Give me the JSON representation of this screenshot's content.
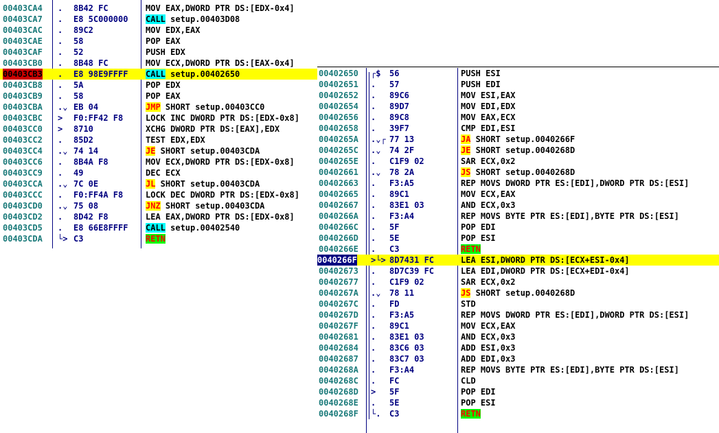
{
  "left_pane": {
    "rows": [
      {
        "addr": "00403CA4",
        "mark": ".",
        "hex": "8B42 FC",
        "kw": "",
        "kwt": "plain",
        "rest": "MOV EAX,DWORD PTR DS:[EDX-0x4]"
      },
      {
        "addr": "00403CA7",
        "mark": ".",
        "hex": "E8 5C000000",
        "kw": "CALL",
        "kwt": "call",
        "rest": " setup.00403D08"
      },
      {
        "addr": "00403CAC",
        "mark": ".",
        "hex": "89C2",
        "kw": "",
        "kwt": "plain",
        "rest": "MOV EDX,EAX"
      },
      {
        "addr": "00403CAE",
        "mark": ".",
        "hex": "58",
        "kw": "",
        "kwt": "plain",
        "rest": "POP EAX"
      },
      {
        "addr": "00403CAF",
        "mark": ".",
        "hex": "52",
        "kw": "",
        "kwt": "plain",
        "rest": "PUSH EDX"
      },
      {
        "addr": "00403CB0",
        "mark": ".",
        "hex": "8B48 FC",
        "kw": "",
        "kwt": "plain",
        "rest": "MOV ECX,DWORD PTR DS:[EAX-0x4]"
      },
      {
        "addr": "00403CB3",
        "mark": ".",
        "hex": "E8 98E9FFFF",
        "kw": "CALL",
        "kwt": "call",
        "rest": " setup.00402650",
        "current": true
      },
      {
        "addr": "00403CB8",
        "mark": ".",
        "hex": "5A",
        "kw": "",
        "kwt": "plain",
        "rest": "POP EDX"
      },
      {
        "addr": "00403CB9",
        "mark": ".",
        "hex": "58",
        "kw": "",
        "kwt": "plain",
        "rest": "POP EAX"
      },
      {
        "addr": "00403CBA",
        "mark": ".⌄",
        "hex": "EB 04",
        "kw": "JMP",
        "kwt": "jmp",
        "rest": " SHORT setup.00403CC0"
      },
      {
        "addr": "00403CBC",
        "mark": ">",
        "hex": "F0:FF42 F8",
        "kw": "",
        "kwt": "plain",
        "rest": "LOCK INC DWORD PTR DS:[EDX-0x8]"
      },
      {
        "addr": "00403CC0",
        "mark": ">",
        "hex": "8710",
        "kw": "",
        "kwt": "plain",
        "rest": "XCHG DWORD PTR DS:[EAX],EDX"
      },
      {
        "addr": "00403CC2",
        "mark": ".",
        "hex": "85D2",
        "kw": "",
        "kwt": "plain",
        "rest": "TEST EDX,EDX"
      },
      {
        "addr": "00403CC4",
        "mark": ".⌄",
        "hex": "74 14",
        "kw": "JE",
        "kwt": "jcc",
        "rest": " SHORT setup.00403CDA"
      },
      {
        "addr": "00403CC6",
        "mark": ".",
        "hex": "8B4A F8",
        "kw": "",
        "kwt": "plain",
        "rest": "MOV ECX,DWORD PTR DS:[EDX-0x8]"
      },
      {
        "addr": "00403CC9",
        "mark": ".",
        "hex": "49",
        "kw": "",
        "kwt": "plain",
        "rest": "DEC ECX"
      },
      {
        "addr": "00403CCA",
        "mark": ".⌄",
        "hex": "7C 0E",
        "kw": "JL",
        "kwt": "jcc",
        "rest": " SHORT setup.00403CDA"
      },
      {
        "addr": "00403CCC",
        "mark": ".",
        "hex": "F0:FF4A F8",
        "kw": "",
        "kwt": "plain",
        "rest": "LOCK DEC DWORD PTR DS:[EDX-0x8]"
      },
      {
        "addr": "00403CD0",
        "mark": ".⌄",
        "hex": "75 08",
        "kw": "JNZ",
        "kwt": "jcc",
        "rest": " SHORT setup.00403CDA"
      },
      {
        "addr": "00403CD2",
        "mark": ".",
        "hex": "8D42 F8",
        "kw": "",
        "kwt": "plain",
        "rest": "LEA EAX,DWORD PTR DS:[EDX-0x8]"
      },
      {
        "addr": "00403CD5",
        "mark": ".",
        "hex": "E8 66E8FFFF",
        "kw": "CALL",
        "kwt": "call",
        "rest": " setup.00402540"
      },
      {
        "addr": "00403CDA",
        "mark": "└>",
        "hex": "C3",
        "kw": "RETN",
        "kwt": "retn",
        "rest": ""
      }
    ]
  },
  "right_pane": {
    "rows": [
      {
        "addr": "00402650",
        "mark": "┌$",
        "hex": "56",
        "kw": "",
        "kwt": "plain",
        "rest": "PUSH ESI"
      },
      {
        "addr": "00402651",
        "mark": ".",
        "hex": "57",
        "kw": "",
        "kwt": "plain",
        "rest": "PUSH EDI"
      },
      {
        "addr": "00402652",
        "mark": ".",
        "hex": "89C6",
        "kw": "",
        "kwt": "plain",
        "rest": "MOV ESI,EAX"
      },
      {
        "addr": "00402654",
        "mark": ".",
        "hex": "89D7",
        "kw": "",
        "kwt": "plain",
        "rest": "MOV EDI,EDX"
      },
      {
        "addr": "00402656",
        "mark": ".",
        "hex": "89C8",
        "kw": "",
        "kwt": "plain",
        "rest": "MOV EAX,ECX"
      },
      {
        "addr": "00402658",
        "mark": ".",
        "hex": "39F7",
        "kw": "",
        "kwt": "plain",
        "rest": "CMP EDI,ESI"
      },
      {
        "addr": "0040265A",
        "mark": ".⌄┌",
        "hex": "77 13",
        "kw": "JA",
        "kwt": "jcc",
        "rest": " SHORT setup.0040266F"
      },
      {
        "addr": "0040265C",
        "mark": ".⌄",
        "hex": "74 2F",
        "kw": "JE",
        "kwt": "jcc",
        "rest": " SHORT setup.0040268D"
      },
      {
        "addr": "0040265E",
        "mark": ".",
        "hex": "C1F9 02",
        "kw": "",
        "kwt": "plain",
        "rest": "SAR ECX,0x2"
      },
      {
        "addr": "00402661",
        "mark": ".⌄",
        "hex": "78 2A",
        "kw": "JS",
        "kwt": "jcc",
        "rest": " SHORT setup.0040268D"
      },
      {
        "addr": "00402663",
        "mark": ".",
        "hex": "F3:A5",
        "kw": "",
        "kwt": "plain",
        "rest": "REP MOVS DWORD PTR ES:[EDI],DWORD PTR DS:[ESI]"
      },
      {
        "addr": "00402665",
        "mark": ".",
        "hex": "89C1",
        "kw": "",
        "kwt": "plain",
        "rest": "MOV ECX,EAX"
      },
      {
        "addr": "00402667",
        "mark": ".",
        "hex": "83E1 03",
        "kw": "",
        "kwt": "plain",
        "rest": "AND ECX,0x3"
      },
      {
        "addr": "0040266A",
        "mark": ".",
        "hex": "F3:A4",
        "kw": "",
        "kwt": "plain",
        "rest": "REP MOVS BYTE PTR ES:[EDI],BYTE PTR DS:[ESI]"
      },
      {
        "addr": "0040266C",
        "mark": ".",
        "hex": "5F",
        "kw": "",
        "kwt": "plain",
        "rest": "POP EDI"
      },
      {
        "addr": "0040266D",
        "mark": ".",
        "hex": "5E",
        "kw": "",
        "kwt": "plain",
        "rest": "POP ESI"
      },
      {
        "addr": "0040266E",
        "mark": ".",
        "hex": "C3",
        "kw": "RETN",
        "kwt": "retn",
        "rest": ""
      },
      {
        "addr": "0040266F",
        "mark": ">└>",
        "hex": "8D7431 FC",
        "kw": "",
        "kwt": "plain",
        "rest": "LEA ESI,DWORD PTR DS:[ECX+ESI-0x4]",
        "selected": true
      },
      {
        "addr": "00402673",
        "mark": ".",
        "hex": "8D7C39 FC",
        "kw": "",
        "kwt": "plain",
        "rest": "LEA EDI,DWORD PTR DS:[ECX+EDI-0x4]"
      },
      {
        "addr": "00402677",
        "mark": ".",
        "hex": "C1F9 02",
        "kw": "",
        "kwt": "plain",
        "rest": "SAR ECX,0x2"
      },
      {
        "addr": "0040267A",
        "mark": ".⌄",
        "hex": "78 11",
        "kw": "JS",
        "kwt": "jcc",
        "rest": " SHORT setup.0040268D"
      },
      {
        "addr": "0040267C",
        "mark": ".",
        "hex": "FD",
        "kw": "",
        "kwt": "plain",
        "rest": "STD"
      },
      {
        "addr": "0040267D",
        "mark": ".",
        "hex": "F3:A5",
        "kw": "",
        "kwt": "plain",
        "rest": "REP MOVS DWORD PTR ES:[EDI],DWORD PTR DS:[ESI]"
      },
      {
        "addr": "0040267F",
        "mark": ".",
        "hex": "89C1",
        "kw": "",
        "kwt": "plain",
        "rest": "MOV ECX,EAX"
      },
      {
        "addr": "00402681",
        "mark": ".",
        "hex": "83E1 03",
        "kw": "",
        "kwt": "plain",
        "rest": "AND ECX,0x3"
      },
      {
        "addr": "00402684",
        "mark": ".",
        "hex": "83C6 03",
        "kw": "",
        "kwt": "plain",
        "rest": "ADD ESI,0x3"
      },
      {
        "addr": "00402687",
        "mark": ".",
        "hex": "83C7 03",
        "kw": "",
        "kwt": "plain",
        "rest": "ADD EDI,0x3"
      },
      {
        "addr": "0040268A",
        "mark": ".",
        "hex": "F3:A4",
        "kw": "",
        "kwt": "plain",
        "rest": "REP MOVS BYTE PTR ES:[EDI],BYTE PTR DS:[ESI]"
      },
      {
        "addr": "0040268C",
        "mark": ".",
        "hex": "FC",
        "kw": "",
        "kwt": "plain",
        "rest": "CLD"
      },
      {
        "addr": "0040268D",
        "mark": ">",
        "hex": "5F",
        "kw": "",
        "kwt": "plain",
        "rest": "POP EDI"
      },
      {
        "addr": "0040268E",
        "mark": ".",
        "hex": "5E",
        "kw": "",
        "kwt": "plain",
        "rest": "POP ESI"
      },
      {
        "addr": "0040268F",
        "mark": "└.",
        "hex": "C3",
        "kw": "RETN",
        "kwt": "retn",
        "rest": ""
      }
    ]
  },
  "colors": {
    "address": "#1a7a7a",
    "hex": "#000080",
    "current_line": "#ffff00",
    "current_address": "#cc0000",
    "selected_address": "#000080",
    "call_highlight": "#00ffff",
    "jump_highlight": "#ffff00",
    "retn_highlight": "#00ff00"
  }
}
